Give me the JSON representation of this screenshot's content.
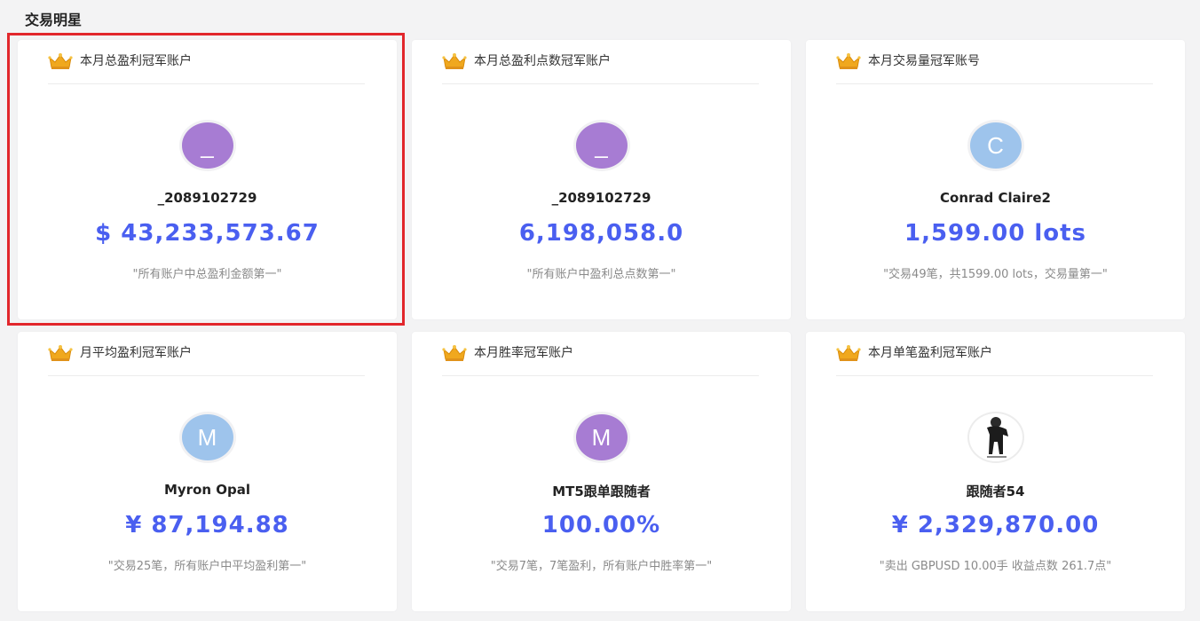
{
  "section": {
    "title": "交易明星"
  },
  "cards": [
    {
      "title": "本月总盈利冠军账户",
      "avatar_text": "_",
      "avatar_color": "purple",
      "name": "_2089102729",
      "value": "$ 43,233,573.67",
      "desc": "\"所有账户中总盈利金额第一\""
    },
    {
      "title": "本月总盈利点数冠军账户",
      "avatar_text": "_",
      "avatar_color": "purple",
      "name": "_2089102729",
      "value": "6,198,058.0",
      "desc": "\"所有账户中盈利总点数第一\""
    },
    {
      "title": "本月交易量冠军账号",
      "avatar_text": "C",
      "avatar_color": "blue",
      "name": "Conrad Claire2",
      "value": "1,599.00 lots",
      "desc": "\"交易49笔，共1599.00 lots，交易量第一\""
    },
    {
      "title": "月平均盈利冠军账户",
      "avatar_text": "M",
      "avatar_color": "blue",
      "name": "Myron Opal",
      "value": "¥ 87,194.88",
      "desc": "\"交易25笔，所有账户中平均盈利第一\""
    },
    {
      "title": "本月胜率冠军账户",
      "avatar_text": "M",
      "avatar_color": "purple",
      "name": "MT5跟单跟随者",
      "value": "100.00%",
      "desc": "\"交易7笔，7笔盈利，所有账户中胜率第一\""
    },
    {
      "title": "本月单笔盈利冠军账户",
      "avatar_text": "",
      "avatar_color": "photo",
      "name": "跟随者54",
      "value": "¥ 2,329,870.00",
      "desc": "\"卖出 GBPUSD 10.00手 收益点数 261.7点\""
    }
  ],
  "colors": {
    "accent": "#4a5ff0",
    "highlight": "#e2272c",
    "purple_avatar": "#a77cd3",
    "blue_avatar": "#9ec4ec",
    "crown": "#f0a81e"
  },
  "icons": {
    "crown": "crown-icon"
  }
}
